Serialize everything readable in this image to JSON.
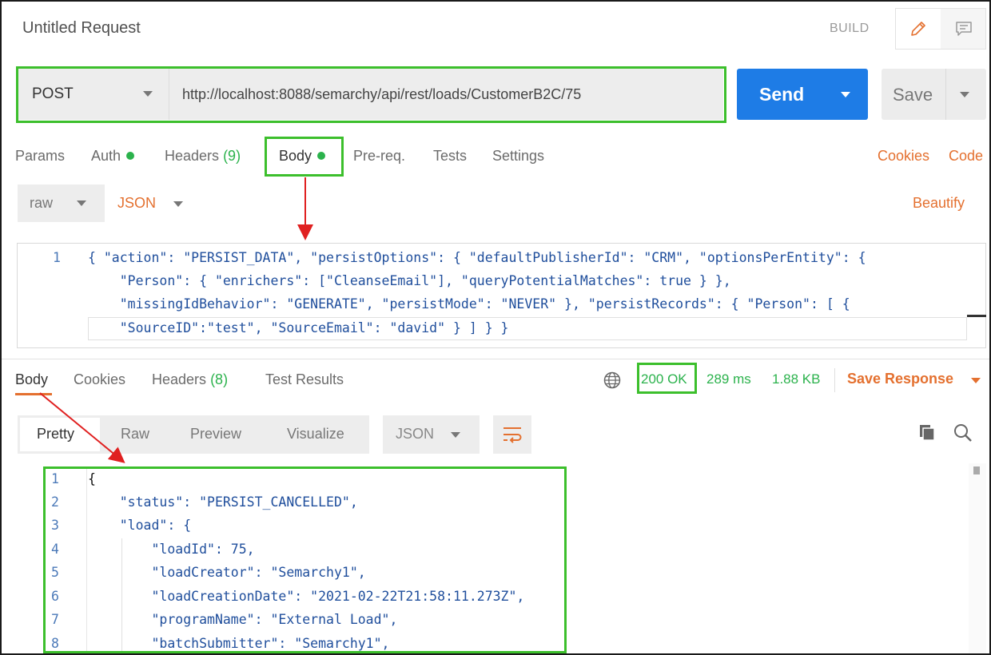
{
  "header": {
    "title": "Untitled Request",
    "build_label": "BUILD",
    "pencil_icon": "pencil-icon",
    "comment_icon": "comment-icon"
  },
  "request": {
    "method": "POST",
    "url": "http://localhost:8088/semarchy/api/rest/loads/CustomerB2C/75",
    "send_label": "Send",
    "save_label": "Save"
  },
  "request_tabs": {
    "params": "Params",
    "auth": "Auth",
    "headers": "Headers",
    "headers_count": "(9)",
    "body": "Body",
    "prereq": "Pre-req.",
    "tests": "Tests",
    "settings": "Settings",
    "cookies": "Cookies",
    "code": "Code"
  },
  "body_options": {
    "mode": "raw",
    "language": "JSON",
    "beautify": "Beautify"
  },
  "request_body": {
    "line_number": "1",
    "lines": [
      "{ \"action\": \"PERSIST_DATA\", \"persistOptions\": { \"defaultPublisherId\": \"CRM\", \"optionsPerEntity\": {",
      "    \"Person\": { \"enrichers\": [\"CleanseEmail\"], \"queryPotentialMatches\": true } },",
      "    \"missingIdBehavior\": \"GENERATE\", \"persistMode\": \"NEVER\" }, \"persistRecords\": { \"Person\": [ {",
      "    \"SourceID\":\"test\", \"SourceEmail\": \"david\" } ] } }"
    ]
  },
  "response_tabs": {
    "body": "Body",
    "cookies": "Cookies",
    "headers": "Headers",
    "headers_count": "(8)",
    "test_results": "Test Results"
  },
  "response_meta": {
    "status": "200 OK",
    "time": "289 ms",
    "size": "1.88 KB",
    "save_response": "Save Response"
  },
  "view_options": {
    "pretty": "Pretty",
    "raw": "Raw",
    "preview": "Preview",
    "visualize": "Visualize",
    "format": "JSON"
  },
  "response_body": {
    "line_numbers": [
      "1",
      "2",
      "3",
      "4",
      "5",
      "6",
      "7",
      "8"
    ],
    "lines": [
      "{",
      "    \"status\": \"PERSIST_CANCELLED\",",
      "    \"load\": {",
      "        \"loadId\": 75,",
      "        \"loadCreator\": \"Semarchy1\",",
      "        \"loadCreationDate\": \"2021-02-22T21:58:11.273Z\",",
      "        \"programName\": \"External Load\",",
      "        \"batchSubmitter\": \"Semarchy1\","
    ]
  },
  "colors": {
    "accent": "#e4702f",
    "send": "#1e7ce6",
    "success": "#2bb24c",
    "highlight_box": "#3cbf2c",
    "annotation_arrow": "#e02020"
  }
}
